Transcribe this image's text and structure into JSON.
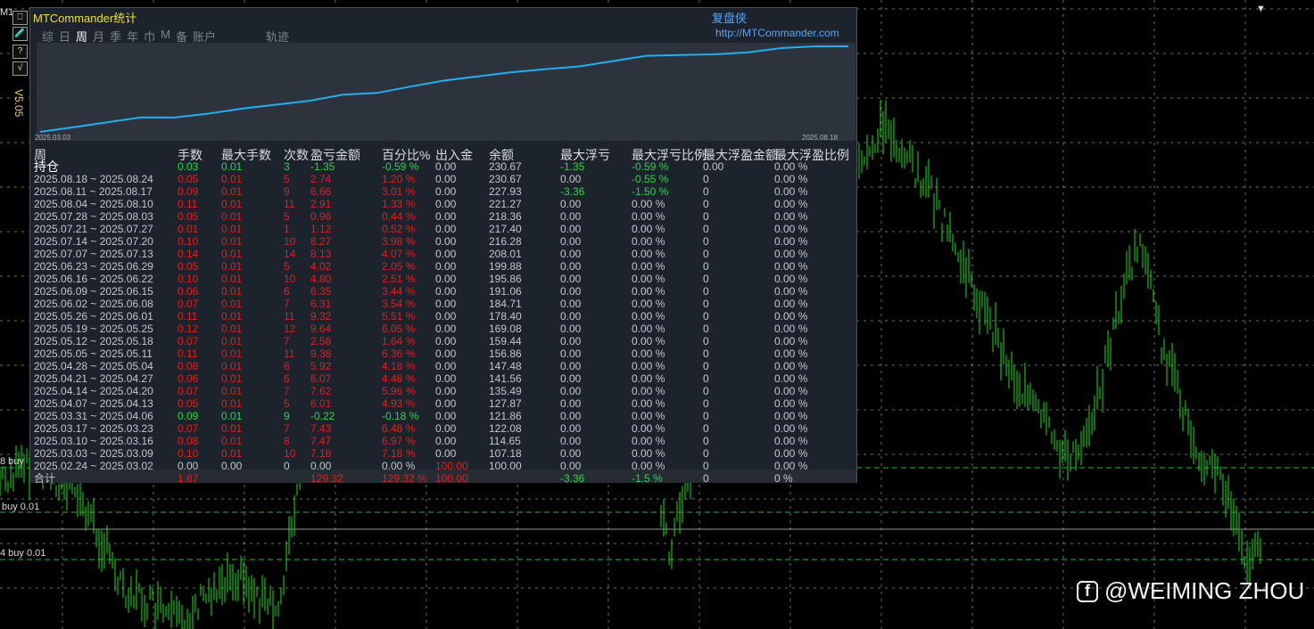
{
  "chart": {
    "timeframe": "M1",
    "orders": [
      "8 buy",
      "buy 0.01",
      "4 buy 0.01"
    ],
    "watermark": "@WEIMING ZHOU"
  },
  "toolbar": {
    "buttons": [
      "⎕",
      "🧪",
      "?",
      "√"
    ],
    "version": "V5.05"
  },
  "panel": {
    "title": "MTCommander统计",
    "brand": "复盘侠",
    "url": "http://MTCommander.com",
    "tabs": [
      "综",
      "日",
      "周",
      "月",
      "季",
      "年",
      "巾",
      "M",
      "备",
      "账户",
      "轨迹"
    ],
    "active_tab": "周",
    "spark_start": "2025.03.03",
    "spark_end": "2025.08.18",
    "headers": [
      "周",
      "手数",
      "最大手数",
      "次数",
      "盈亏金额",
      "百分比%",
      "出入金",
      "余额",
      "最大浮亏",
      "最大浮亏比例",
      "最大浮盈金额",
      "最大浮盈比例"
    ],
    "rows": [
      [
        "持仓",
        "0.03",
        "0.01",
        "3",
        "-1.35",
        "-0.59 %",
        "0.00",
        "230.67",
        "-1.35",
        "-0.59 %",
        "0.00",
        "0.00 %"
      ],
      [
        "2025.08.18 ~ 2025.08.24",
        "0.05",
        "0.01",
        "5",
        "2.74",
        "1.20 %",
        "0.00",
        "230.67",
        "0.00",
        "-0.55 %",
        "0",
        "0.00 %"
      ],
      [
        "2025.08.11 ~ 2025.08.17",
        "0.09",
        "0.01",
        "9",
        "6.66",
        "3.01 %",
        "0.00",
        "227.93",
        "-3.36",
        "-1.50 %",
        "0",
        "0.00 %"
      ],
      [
        "2025.08.04 ~ 2025.08.10",
        "0.11",
        "0.01",
        "11",
        "2.91",
        "1.33 %",
        "0.00",
        "221.27",
        "0.00",
        "0.00 %",
        "0",
        "0.00 %"
      ],
      [
        "2025.07.28 ~ 2025.08.03",
        "0.05",
        "0.01",
        "5",
        "0.96",
        "0.44 %",
        "0.00",
        "218.36",
        "0.00",
        "0.00 %",
        "0",
        "0.00 %"
      ],
      [
        "2025.07.21 ~ 2025.07.27",
        "0.01",
        "0.01",
        "1",
        "1.12",
        "0.52 %",
        "0.00",
        "217.40",
        "0.00",
        "0.00 %",
        "0",
        "0.00 %"
      ],
      [
        "2025.07.14 ~ 2025.07.20",
        "0.10",
        "0.01",
        "10",
        "8.27",
        "3.98 %",
        "0.00",
        "216.28",
        "0.00",
        "0.00 %",
        "0",
        "0.00 %"
      ],
      [
        "2025.07.07 ~ 2025.07.13",
        "0.14",
        "0.01",
        "14",
        "8.13",
        "4.07 %",
        "0.00",
        "208.01",
        "0.00",
        "0.00 %",
        "0",
        "0.00 %"
      ],
      [
        "2025.06.23 ~ 2025.06.29",
        "0.05",
        "0.01",
        "5",
        "4.02",
        "2.05 %",
        "0.00",
        "199.88",
        "0.00",
        "0.00 %",
        "0",
        "0.00 %"
      ],
      [
        "2025.06.16 ~ 2025.06.22",
        "0.10",
        "0.01",
        "10",
        "4.80",
        "2.51 %",
        "0.00",
        "195.86",
        "0.00",
        "0.00 %",
        "0",
        "0.00 %"
      ],
      [
        "2025.06.09 ~ 2025.06.15",
        "0.06",
        "0.01",
        "6",
        "6.35",
        "3.44 %",
        "0.00",
        "191.06",
        "0.00",
        "0.00 %",
        "0",
        "0.00 %"
      ],
      [
        "2025.06.02 ~ 2025.06.08",
        "0.07",
        "0.01",
        "7",
        "6.31",
        "3.54 %",
        "0.00",
        "184.71",
        "0.00",
        "0.00 %",
        "0",
        "0.00 %"
      ],
      [
        "2025.05.26 ~ 2025.06.01",
        "0.11",
        "0.01",
        "11",
        "9.32",
        "5.51 %",
        "0.00",
        "178.40",
        "0.00",
        "0.00 %",
        "0",
        "0.00 %"
      ],
      [
        "2025.05.19 ~ 2025.05.25",
        "0.12",
        "0.01",
        "12",
        "9.64",
        "6.05 %",
        "0.00",
        "169.08",
        "0.00",
        "0.00 %",
        "0",
        "0.00 %"
      ],
      [
        "2025.05.12 ~ 2025.05.18",
        "0.07",
        "0.01",
        "7",
        "2.58",
        "1.64 %",
        "0.00",
        "159.44",
        "0.00",
        "0.00 %",
        "0",
        "0.00 %"
      ],
      [
        "2025.05.05 ~ 2025.05.11",
        "0.11",
        "0.01",
        "11",
        "9.38",
        "6.36 %",
        "0.00",
        "156.86",
        "0.00",
        "0.00 %",
        "0",
        "0.00 %"
      ],
      [
        "2025.04.28 ~ 2025.05.04",
        "0.08",
        "0.01",
        "8",
        "5.92",
        "4.18 %",
        "0.00",
        "147.48",
        "0.00",
        "0.00 %",
        "0",
        "0.00 %"
      ],
      [
        "2025.04.21 ~ 2025.04.27",
        "0.06",
        "0.01",
        "6",
        "6.07",
        "4.48 %",
        "0.00",
        "141.56",
        "0.00",
        "0.00 %",
        "0",
        "0.00 %"
      ],
      [
        "2025.04.14 ~ 2025.04.20",
        "0.07",
        "0.01",
        "7",
        "7.62",
        "5.96 %",
        "0.00",
        "135.49",
        "0.00",
        "0.00 %",
        "0",
        "0.00 %"
      ],
      [
        "2025.04.07 ~ 2025.04.13",
        "0.05",
        "0.01",
        "5",
        "6.01",
        "4.93 %",
        "0.00",
        "127.87",
        "0.00",
        "0.00 %",
        "0",
        "0.00 %"
      ],
      [
        "2025.03.31 ~ 2025.04.06",
        "0.09",
        "0.01",
        "9",
        "-0.22",
        "-0.18 %",
        "0.00",
        "121.86",
        "0.00",
        "0.00 %",
        "0",
        "0.00 %"
      ],
      [
        "2025.03.17 ~ 2025.03.23",
        "0.07",
        "0.01",
        "7",
        "7.43",
        "6.48 %",
        "0.00",
        "122.08",
        "0.00",
        "0.00 %",
        "0",
        "0.00 %"
      ],
      [
        "2025.03.10 ~ 2025.03.16",
        "0.08",
        "0.01",
        "8",
        "7.47",
        "6.97 %",
        "0.00",
        "114.65",
        "0.00",
        "0.00 %",
        "0",
        "0.00 %"
      ],
      [
        "2025.03.03 ~ 2025.03.09",
        "0.10",
        "0.01",
        "10",
        "7.18",
        "7.18 %",
        "0.00",
        "107.18",
        "0.00",
        "0.00 %",
        "0",
        "0.00 %"
      ],
      [
        "2025.02.24 ~ 2025.03.02",
        "0.00",
        "0.00",
        "0",
        "0.00",
        "0.00 %",
        "100.00",
        "100.00",
        "0.00",
        "0.00 %",
        "0",
        "0.00 %"
      ]
    ],
    "total": [
      "合计",
      "1.87",
      "",
      "",
      "129.32",
      "129.32 %",
      "100.00",
      "",
      "-3.36",
      "-1.5 %",
      "0",
      "0 %"
    ],
    "equity_curve": [
      100.0,
      107.18,
      114.65,
      122.08,
      121.86,
      127.87,
      135.49,
      141.56,
      147.48,
      156.86,
      159.44,
      169.08,
      178.4,
      184.71,
      191.06,
      195.86,
      199.88,
      208.01,
      216.28,
      217.4,
      218.36,
      221.27,
      227.93,
      230.67,
      229.32
    ],
    "colors": {
      "up": "#27d944",
      "down": "#e0201f",
      "neutral": "#c3c8ce",
      "curve": "#22aef0"
    }
  }
}
